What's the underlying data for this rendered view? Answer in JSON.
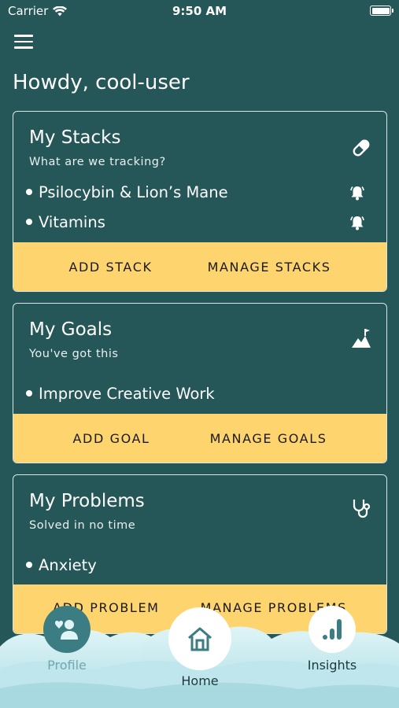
{
  "status": {
    "carrier": "Carrier",
    "time": "9:50 AM"
  },
  "greeting": "Howdy, cool-user",
  "stacks": {
    "title": "My Stacks",
    "subtitle": "What are we tracking?",
    "icon": "pill-icon",
    "items": [
      {
        "label": "Psilocybin & Lion’s Mane",
        "icon": "bell-ringing-icon"
      },
      {
        "label": "Vitamins",
        "icon": "bell-ringing-icon"
      }
    ],
    "add_label": "ADD STACK",
    "manage_label": "MANAGE STACKS"
  },
  "goals": {
    "title": "My Goals",
    "subtitle": "You've got this",
    "icon": "mountain-flag-icon",
    "items": [
      {
        "label": "Improve Creative Work"
      }
    ],
    "add_label": "ADD GOAL",
    "manage_label": "MANAGE GOALS"
  },
  "problems": {
    "title": "My Problems",
    "subtitle": "Solved in no time",
    "icon": "stethoscope-icon",
    "items": [
      {
        "label": "Anxiety"
      }
    ],
    "add_label": "ADD PROBLEM",
    "manage_label": "MANAGE PROBLEMS"
  },
  "tabs": {
    "profile": "Profile",
    "home": "Home",
    "insights": "Insights"
  },
  "colors": {
    "background": "#255658",
    "accent": "#fdd46d",
    "cloud": "#cfeef2",
    "tab_teal": "#3b7d83"
  }
}
